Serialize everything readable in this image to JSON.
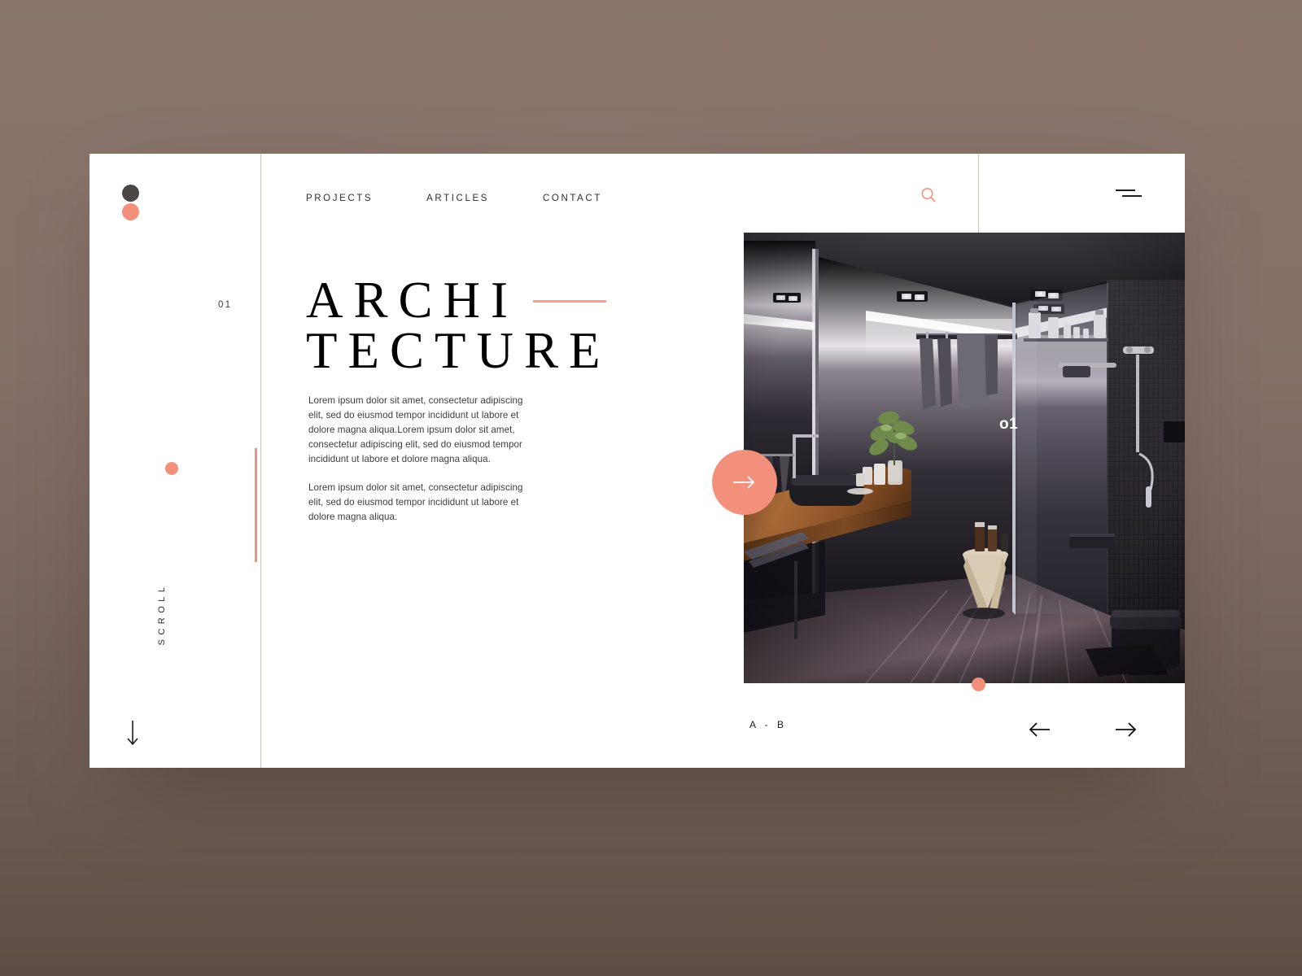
{
  "theme": {
    "backdrop": "#857068",
    "card_bg": "#ffffff",
    "accent_coral": "#F3907B",
    "accent_coral_light": "#F7A08E",
    "dark_dot": "#4a4644",
    "rule": "#cfc3bd",
    "text": "#2d2d2d"
  },
  "nav": {
    "items": [
      {
        "label": "PROJECTS"
      },
      {
        "label": "ARTICLES"
      },
      {
        "label": "CONTACT"
      }
    ],
    "search_icon": "search-icon",
    "menu_icon": "hamburger-menu-icon"
  },
  "brand": {
    "dot_top": "logo-dot-dark",
    "dot_bottom": "logo-dot-coral"
  },
  "rail": {
    "scroll_label": "SCROLL",
    "scroll_arrow_icon": "arrow-down-icon",
    "progress_dot": "rail-progress-dot"
  },
  "hero": {
    "index": "01",
    "title_line_1": "ARCHI",
    "title_line_2": "TECTURE",
    "paragraphs": [
      "Lorem ipsum dolor sit amet, consectetur adipiscing elit, sed do eiusmod tempor incididunt ut labore et dolore magna aliqua.Lorem ipsum dolor sit amet, consectetur adipiscing elit, sed do eiusmod tempor incididunt ut labore et dolore magna aliqua.",
      "Lorem ipsum dolor sit amet, consectetur adipiscing elit, sed do eiusmod tempor incididunt ut labore et dolore magna aliqua."
    ]
  },
  "showcase": {
    "image_alt": "dark-modern-bathroom-interior",
    "image_label": "o1",
    "cta_icon": "arrow-right-icon",
    "marker_dot": "image-marker-dot"
  },
  "footer": {
    "range_label": "A - B",
    "prev_icon": "arrow-left-icon",
    "next_icon": "arrow-right-icon"
  }
}
